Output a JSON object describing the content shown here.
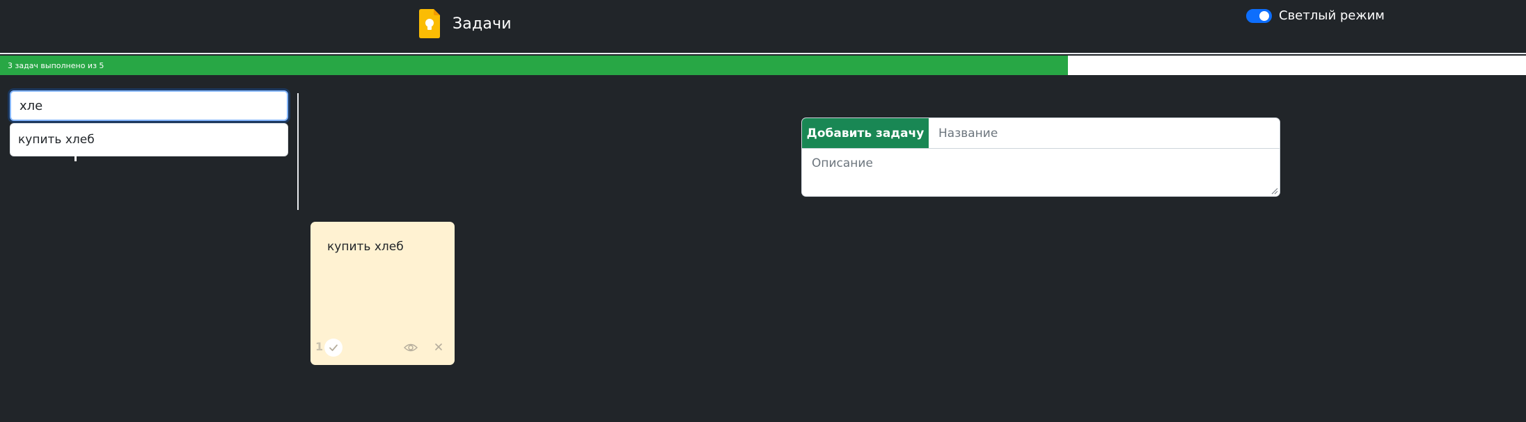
{
  "header": {
    "title": "Задачи",
    "brand_icon": "keep-bulb-icon",
    "theme_toggle": {
      "label": "Светлый режим",
      "checked": true
    }
  },
  "progress": {
    "text": "3 задач выполнено из 5",
    "completed": 3,
    "total": 5,
    "fraction": 0.7
  },
  "search": {
    "value": "хле",
    "suggestions": [
      "купить хлеб"
    ]
  },
  "add_task": {
    "button_label": "Добавить задачу",
    "title_placeholder": "Название",
    "description_placeholder": "Описание"
  },
  "tasks": [
    {
      "number": "1",
      "title": "купить хлеб",
      "done": false
    }
  ],
  "icons": {
    "done": "check-icon",
    "view": "eye-icon",
    "delete": "close-icon"
  },
  "colors": {
    "background": "#212529",
    "progress": "#28a745",
    "add_button": "#198754",
    "toggle": "#0d6efd",
    "card": "#fff2d2",
    "brand_icon": "#fbbc04"
  }
}
